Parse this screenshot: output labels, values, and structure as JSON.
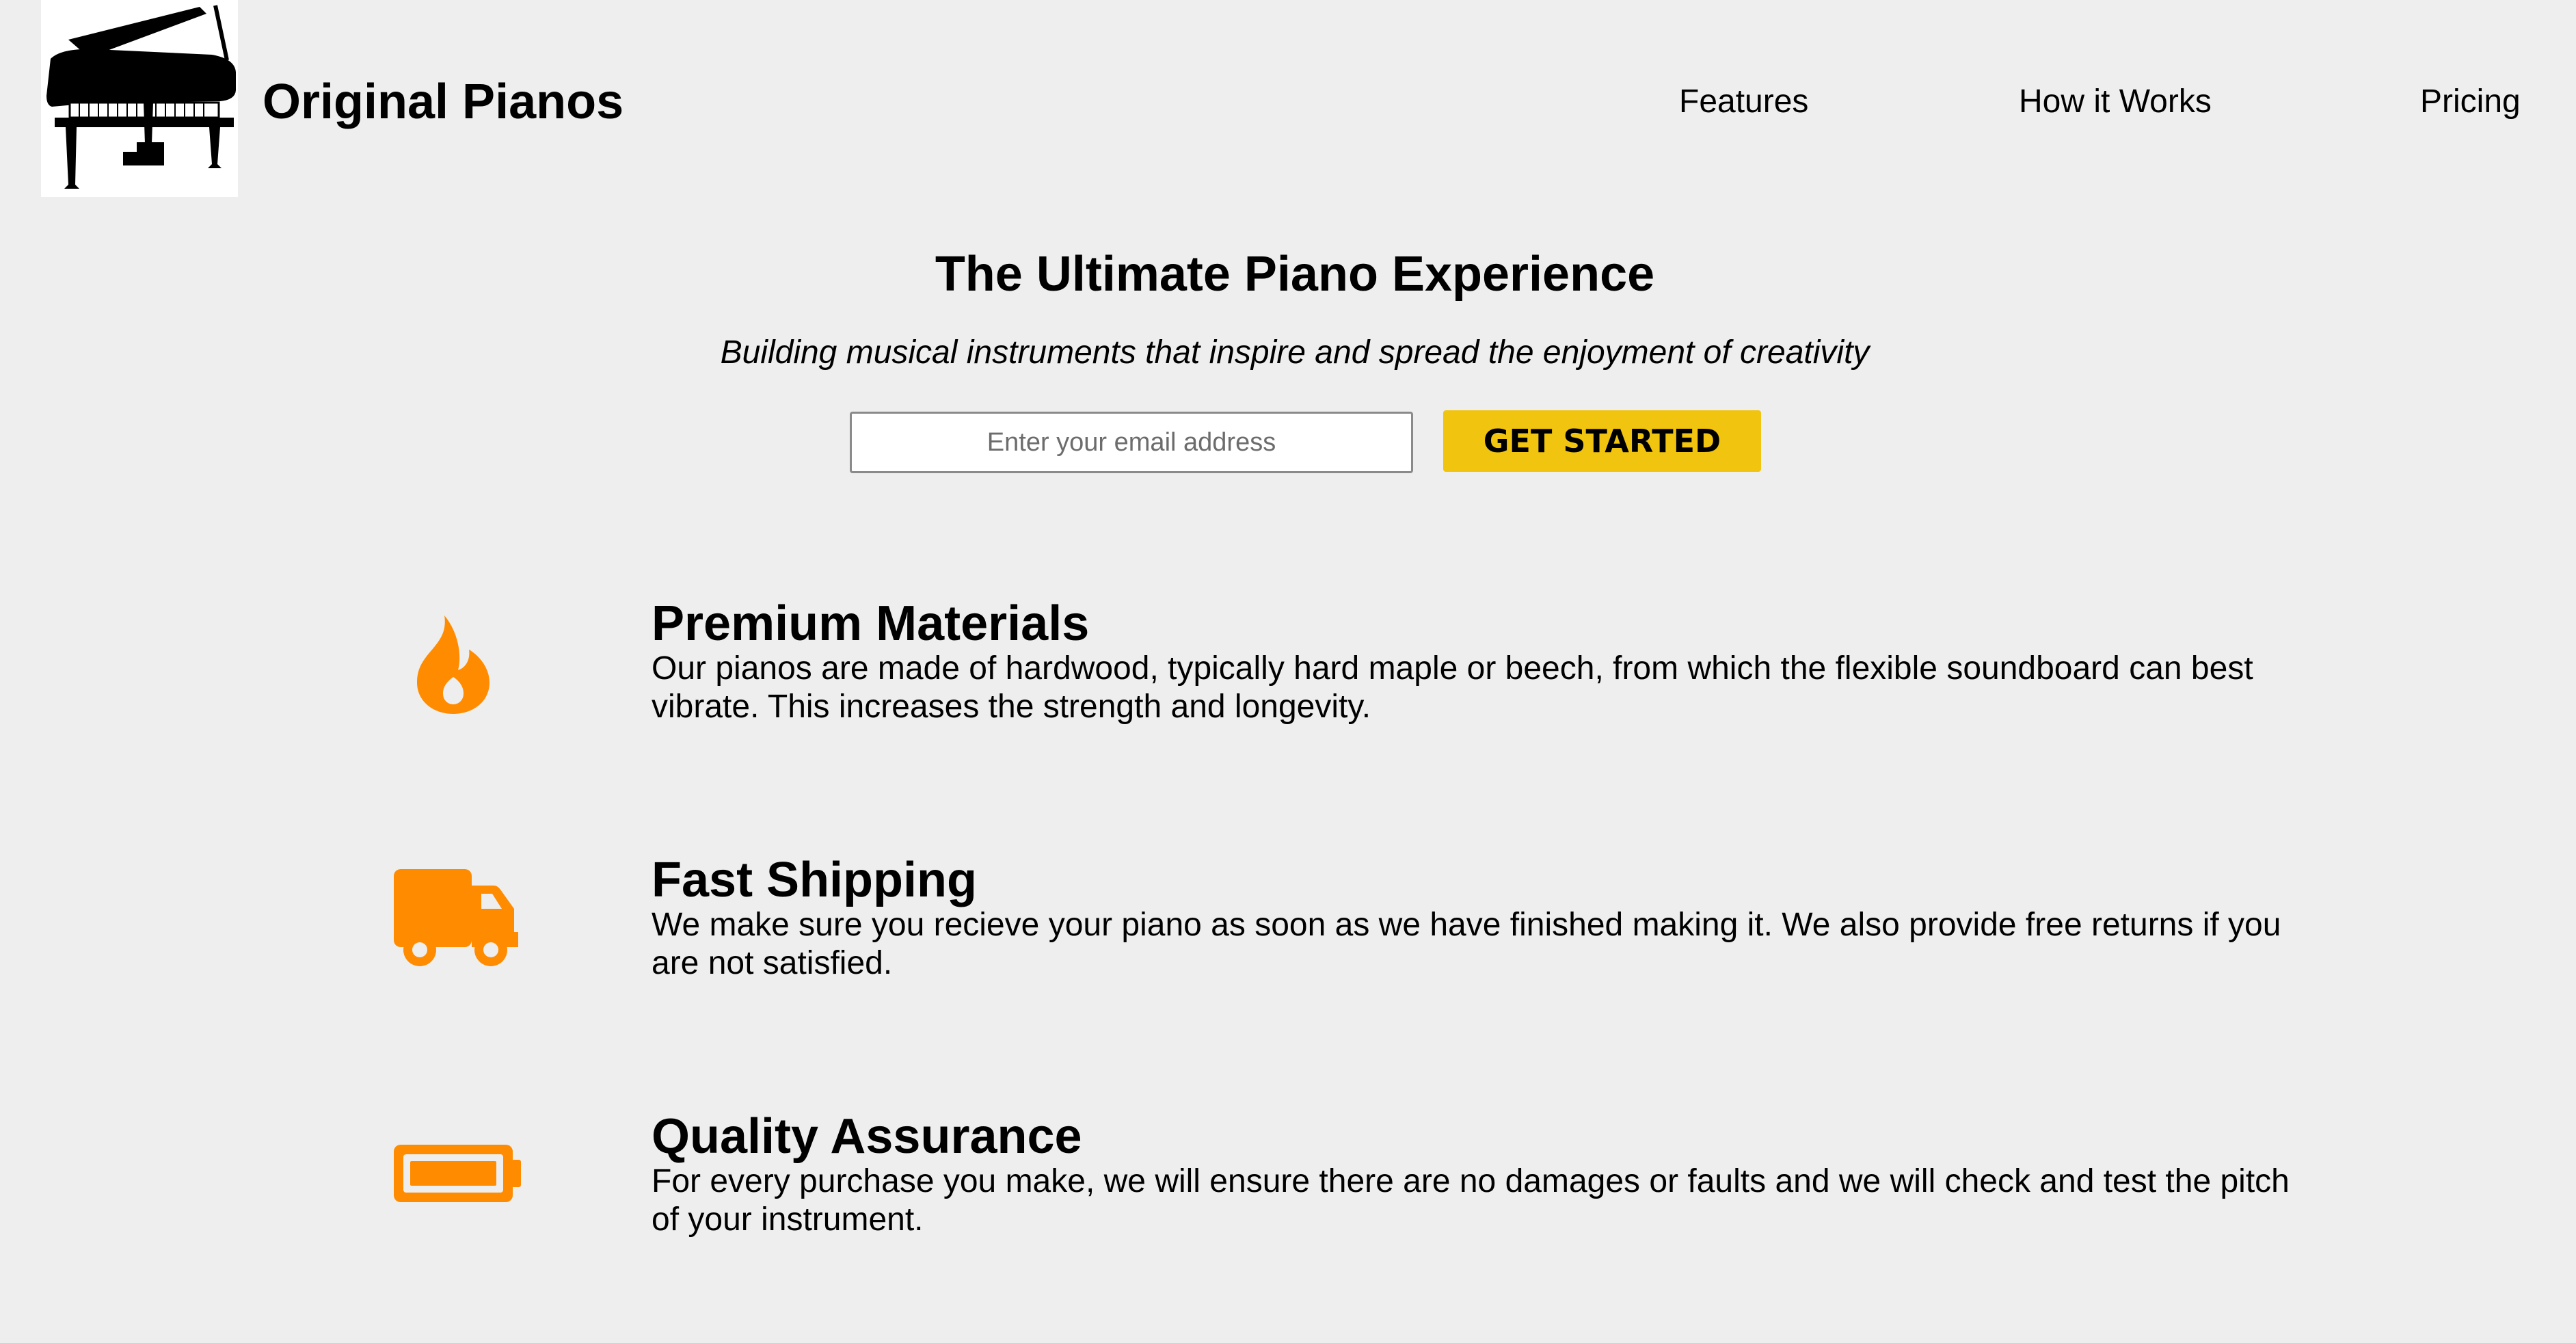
{
  "header": {
    "logo_icon": "grand-piano-icon",
    "brand_name": "Original Pianos",
    "nav": [
      {
        "label": "Features"
      },
      {
        "label": "How it Works"
      },
      {
        "label": "Pricing"
      }
    ]
  },
  "hero": {
    "title": "The Ultimate Piano Experience",
    "subtitle": "Building musical instruments that inspire and spread the enjoyment of creativity",
    "email_placeholder": "Enter your email address",
    "cta_label": "GET STARTED"
  },
  "features": [
    {
      "icon": "fire-icon",
      "title": "Premium Materials",
      "description": "Our pianos are made of hardwood, typically hard maple or beech, from which the flexible soundboard can best vibrate. This increases the strength and longevity."
    },
    {
      "icon": "truck-icon",
      "title": "Fast Shipping",
      "description": "We make sure you recieve your piano as soon as we have finished making it. We also provide free returns if you are not satisfied."
    },
    {
      "icon": "battery-icon",
      "title": "Quality Assurance",
      "description": "For every purchase you make, we will ensure there are no damages or faults and we will check and test the pitch of your instrument."
    }
  ],
  "colors": {
    "page_background": "#eeeeee",
    "accent_orange": "#ff8c00",
    "button_yellow": "#f1c40f",
    "text": "#000000"
  }
}
